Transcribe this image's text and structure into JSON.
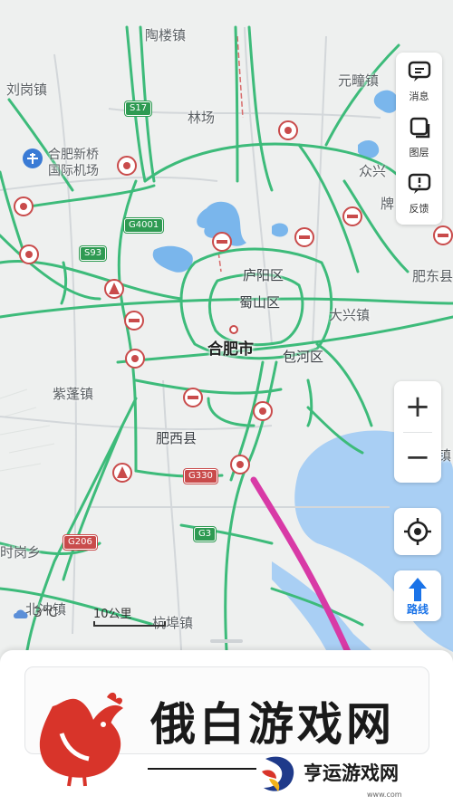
{
  "map": {
    "city": "合肥市",
    "districts": [
      "庐阳区",
      "蜀山区",
      "包河区",
      "肥西县"
    ],
    "towns": [
      "陶楼镇",
      "刘岗镇",
      "林场",
      "元疃镇",
      "众兴",
      "牌",
      "大兴镇",
      "肥东县",
      "紫蓬镇",
      "杭埠镇",
      "北冲镇",
      "时岗乡",
      "镇"
    ],
    "airport": [
      "合肥新桥",
      "国际机场"
    ],
    "highways": [
      "S17",
      "G4001",
      "S93",
      "G330",
      "G3",
      "G206"
    ]
  },
  "right_panel": {
    "messages": "消息",
    "layers": "图层",
    "feedback": "反馈"
  },
  "controls": {
    "zoom_in": "+",
    "zoom_out": "−",
    "route": "路线"
  },
  "weather": {
    "temp": "3°C"
  },
  "scale": {
    "label": "10公里"
  },
  "watermark": {
    "title": "俄白游戏网",
    "subtitle": "亨运游戏网",
    "url": "www.com"
  },
  "colors": {
    "road": "#3dbb7a",
    "lake": "#7ab6ec",
    "water": "#a9cff4",
    "accent": "#1a73e8"
  }
}
